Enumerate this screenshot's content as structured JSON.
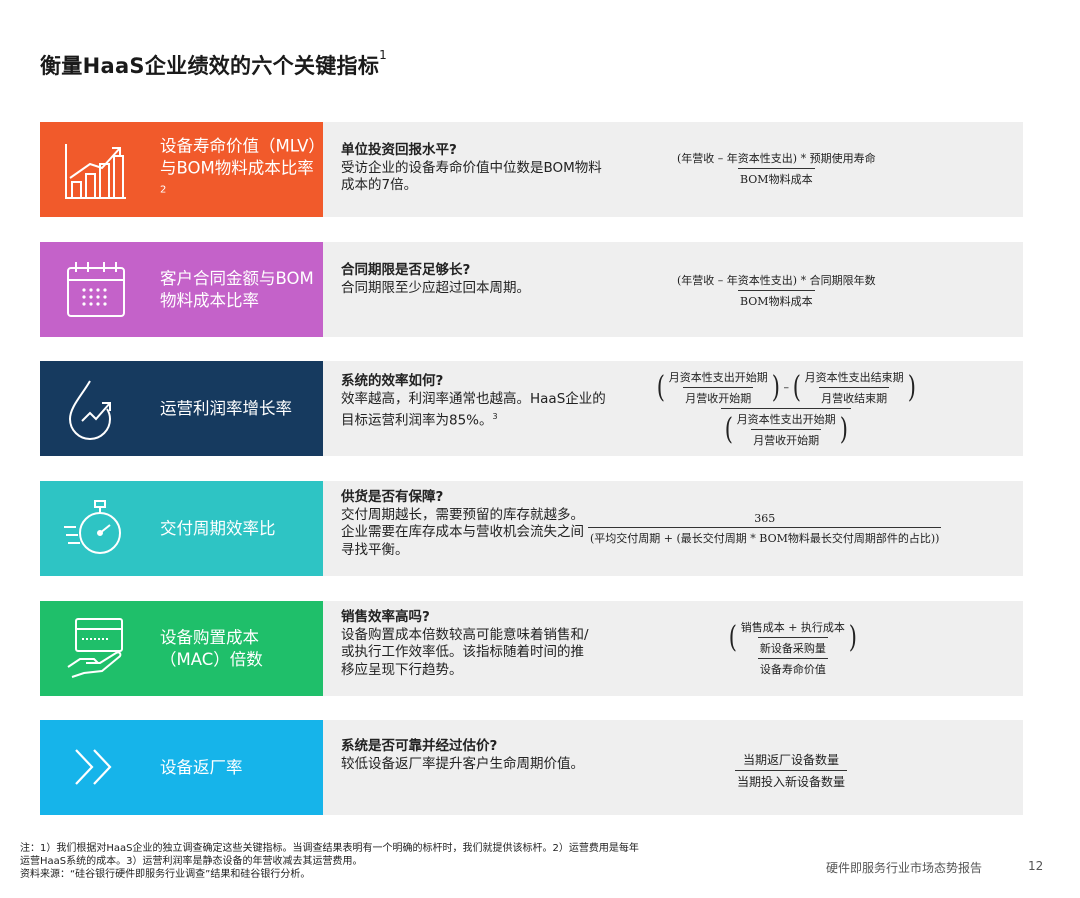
{
  "page": {
    "title": "衡量HaaS企业绩效的六个关键指标",
    "title_note": "1"
  },
  "rows": [
    {
      "color": "#f15a2b",
      "icon": "bar-chart-growth-icon",
      "name": "设备寿命价值（MLV）与BOM物料成本比率",
      "name_note": "2",
      "question": "单位投资回报水平?",
      "description": "受访企业的设备寿命价值中位数是BOM物料成本的7倍。",
      "formula": {
        "num": "(年营收 – 年资本性支出) * 预期使用寿命",
        "den": "BOM物料成本"
      }
    },
    {
      "color": "#c462c9",
      "icon": "calendar-icon",
      "name": "客户合同金额与BOM物料成本比率",
      "question": "合同期限是否足够长?",
      "description": "合同期限至少应超过回本周期。",
      "formula": {
        "num": "(年营收 – 年资本性支出) * 合同期限年数",
        "den": "BOM物料成本"
      }
    },
    {
      "color": "#163a5f",
      "icon": "droplet-growth-icon",
      "name": "运营利润率增长率",
      "question": "系统的效率如何?",
      "description": "效率越高，利润率通常也越高。HaaS企业的目标运营利润率为85%。",
      "description_note": "3",
      "formula": {
        "a_num": "月资本性支出开始期",
        "a_den": "月营收开始期",
        "b_num": "月资本性支出结束期",
        "b_den": "月营收结束期",
        "c_num": "月资本性支出开始期",
        "c_den": "月营收开始期",
        "minus": "–"
      }
    },
    {
      "color": "#2ec4c4",
      "icon": "stopwatch-icon",
      "name": "交付周期效率比",
      "question": "供货是否有保障?",
      "description": "交付周期越长，需要预留的库存就越多。企业需要在库存成本与营收机会流失之间寻找平衡。",
      "formula": {
        "num": "365",
        "den": "(平均交付周期 + (最长交付周期 * BOM物料最长交付周期部件的占比))"
      }
    },
    {
      "color": "#1fbf6a",
      "icon": "hand-card-icon",
      "name": "设备购置成本（MAC）倍数",
      "question": "销售效率高吗?",
      "description": "设备购置成本倍数较高可能意味着销售和/或执行工作效率低。该指标随着时间的推移应呈现下行趋势。",
      "formula": {
        "inner_num": "销售成本 + 执行成本",
        "inner_den": "新设备采购量",
        "den": "设备寿命价值"
      }
    },
    {
      "color": "#16b4ea",
      "icon": "double-chevron-right-icon",
      "name": "设备返厂率",
      "question": "系统是否可靠并经过估价?",
      "description": "较低设备返厂率提升客户生命周期价值。",
      "formula": {
        "num": "当期返厂设备数量",
        "den": "当期投入新设备数量"
      }
    }
  ],
  "footnote": {
    "line1": "注：1）我们根据对HaaS企业的独立调查确定这些关键指标。当调查结果表明有一个明确的标杆时，我们就提供该标杆。2）运营费用是每年",
    "line2": "运营HaaS系统的成本。3）运营利润率是静态设备的年营收减去其运营费用。",
    "line3": "资料来源：“硅谷银行硬件即服务行业调查”结果和硅谷银行分析。"
  },
  "footer": {
    "report_title": "硬件即服务行业市场态势报告",
    "page_number": "12"
  }
}
